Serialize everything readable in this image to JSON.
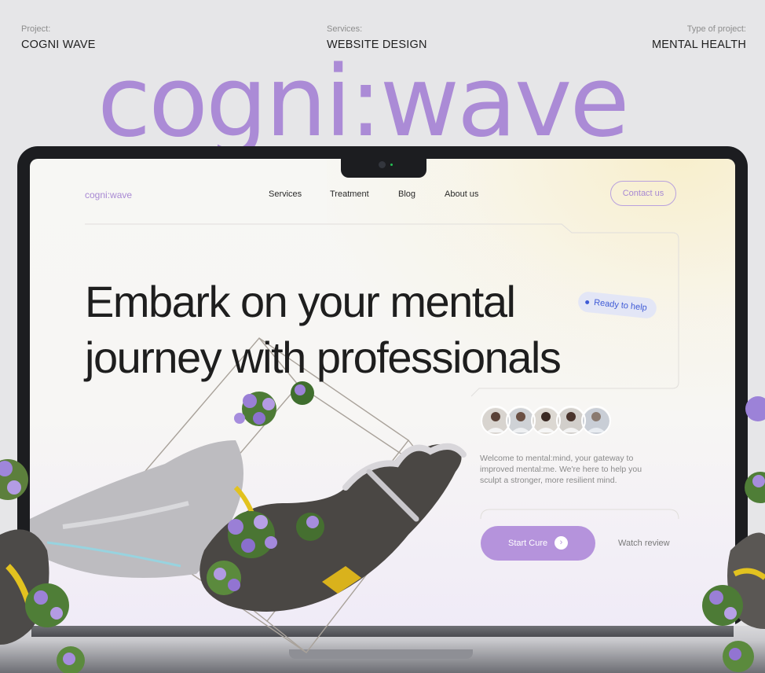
{
  "meta": {
    "project": {
      "label": "Project:",
      "value": "COGNI WAVE"
    },
    "services": {
      "label": "Services:",
      "value": "WEBSITE DESIGN"
    },
    "type": {
      "label": "Type of project:",
      "value": "MENTAL HEALTH"
    }
  },
  "brand_wordmark": "cogni:wave",
  "site": {
    "logo": "cogni:wave",
    "nav": [
      "Services",
      "Treatment",
      "Blog",
      "About us"
    ],
    "contact_label": "Contact us",
    "headline_line1": "Embark on your mental",
    "headline_line2": "journey with professionals",
    "badge": "Ready to help",
    "welcome": "Welcome to mental:mind, your gateway to improved mental:me. We're here to help you sculpt a stronger, more resilient mind.",
    "start_label": "Start Cure",
    "watch_label": "Watch review"
  },
  "colors": {
    "accent": "#ab8bd6",
    "button": "#b593dc",
    "badge_text": "#3f5bd6",
    "background": "#e6e6e8",
    "device": "#1c1d20"
  },
  "icons": {
    "start_arrow": "arrow-right-icon"
  }
}
